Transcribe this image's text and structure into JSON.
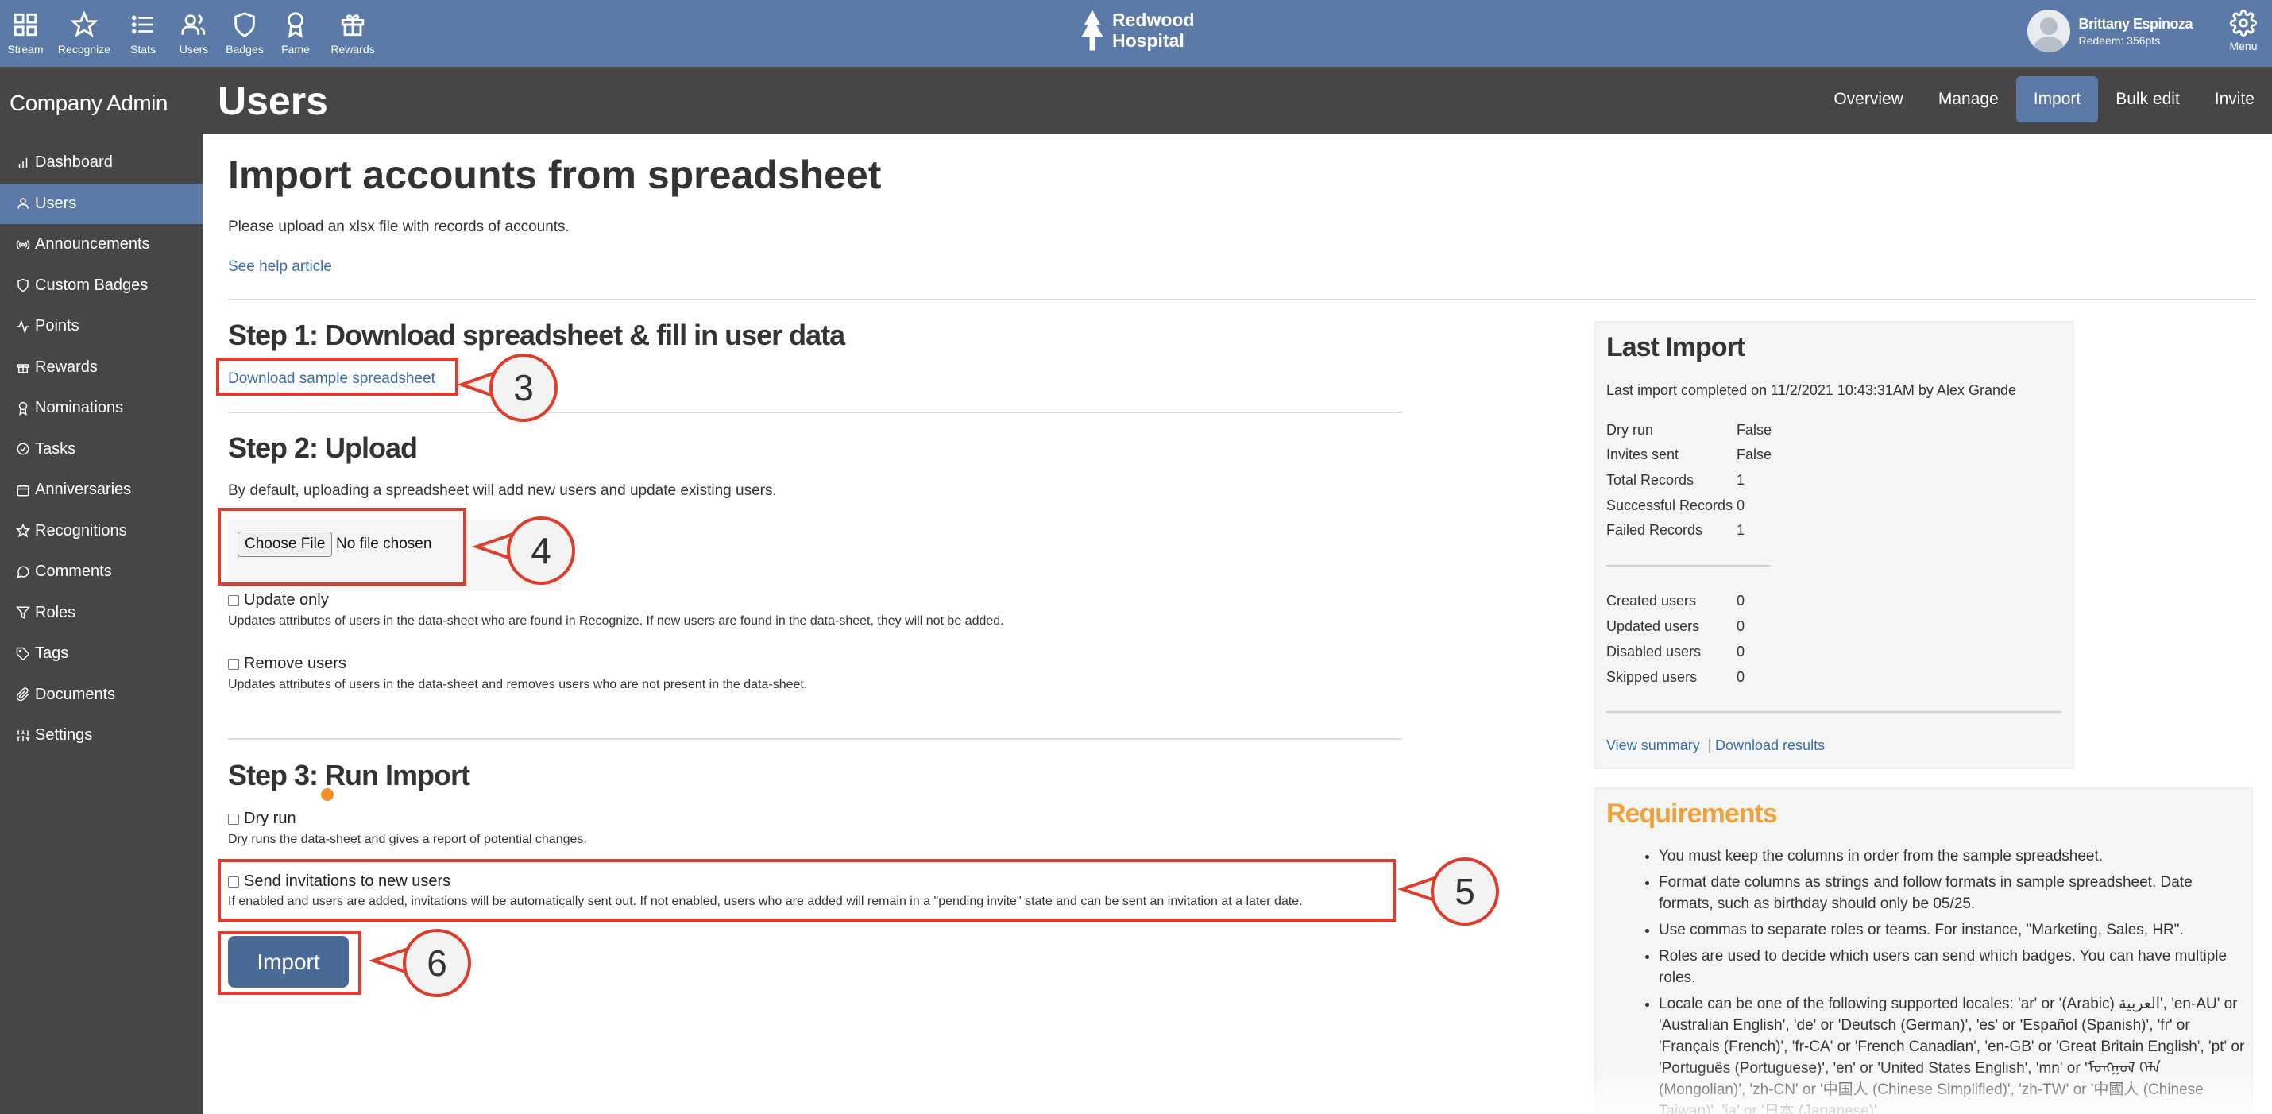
{
  "topnav": {
    "items": [
      {
        "label": "Stream",
        "icon": "grid-icon"
      },
      {
        "label": "Recognize",
        "icon": "star-icon"
      },
      {
        "label": "Stats",
        "icon": "list-icon"
      },
      {
        "label": "Users",
        "icon": "users-icon"
      },
      {
        "label": "Badges",
        "icon": "shield-icon"
      },
      {
        "label": "Fame",
        "icon": "award-icon"
      },
      {
        "label": "Rewards",
        "icon": "gift-icon"
      }
    ],
    "brand_line1": "Redwood",
    "brand_line2": "Hospital",
    "user_name": "Brittany Espinoza",
    "user_points": "Redeem: 356pts",
    "menu_label": "Menu"
  },
  "header": {
    "company": "Company Admin",
    "title": "Users",
    "tabs": [
      "Overview",
      "Manage",
      "Import",
      "Bulk edit",
      "Invite"
    ],
    "active_tab": "Import"
  },
  "sidebar": {
    "items": [
      {
        "label": "Dashboard",
        "icon": "bar-chart-icon"
      },
      {
        "label": "Users",
        "icon": "user-icon"
      },
      {
        "label": "Announcements",
        "icon": "broadcast-icon"
      },
      {
        "label": "Custom Badges",
        "icon": "shield-icon"
      },
      {
        "label": "Points",
        "icon": "pulse-icon"
      },
      {
        "label": "Rewards",
        "icon": "gift-icon"
      },
      {
        "label": "Nominations",
        "icon": "award-icon"
      },
      {
        "label": "Tasks",
        "icon": "check-circle-icon"
      },
      {
        "label": "Anniversaries",
        "icon": "calendar-icon"
      },
      {
        "label": "Recognitions",
        "icon": "star-icon"
      },
      {
        "label": "Comments",
        "icon": "comment-icon"
      },
      {
        "label": "Roles",
        "icon": "filter-icon"
      },
      {
        "label": "Tags",
        "icon": "tag-icon"
      },
      {
        "label": "Documents",
        "icon": "paperclip-icon"
      },
      {
        "label": "Settings",
        "icon": "sliders-icon"
      }
    ],
    "active": "Users"
  },
  "main": {
    "title": "Import accounts from spreadsheet",
    "intro": "Please upload an xlsx file with records of accounts.",
    "help_link": "See help article",
    "step1": {
      "title": "Step 1: Download spreadsheet & fill in user data",
      "link": "Download sample spreadsheet"
    },
    "step2": {
      "title": "Step 2: Upload",
      "desc": "By default, uploading a spreadsheet will add new users and update existing users.",
      "choose_file": "Choose File",
      "no_file": "No file chosen",
      "update_only_label": "Update only",
      "update_only_desc": "Updates attributes of users in the data-sheet who are found in Recognize. If new users are found in the data-sheet, they will not be added.",
      "remove_users_label": "Remove users",
      "remove_users_desc": "Updates attributes of users in the data-sheet and removes users who are not present in the data-sheet."
    },
    "step3": {
      "title": "Step 3: Run Import",
      "dry_run_label": "Dry run",
      "dry_run_desc": "Dry runs the data-sheet and gives a report of potential changes.",
      "send_inv_label": "Send invitations to new users",
      "send_inv_desc": "If enabled and users are added, invitations will be automatically sent out. If not enabled, users who are added will remain in a \"pending invite\" state and can be sent an invitation at a later date.",
      "import_button": "Import"
    }
  },
  "callouts": [
    "3",
    "4",
    "5",
    "6"
  ],
  "last_import": {
    "title": "Last Import",
    "completed": "Last import completed on 11/2/2021 10:43:31AM by Alex Grande",
    "rows1": [
      {
        "label": "Dry run",
        "value": "False"
      },
      {
        "label": "Invites sent",
        "value": "False"
      },
      {
        "label": "Total Records",
        "value": "1"
      },
      {
        "label": "Successful Records",
        "value": "0"
      },
      {
        "label": "Failed Records",
        "value": "1"
      }
    ],
    "rows2": [
      {
        "label": "Created users",
        "value": "0"
      },
      {
        "label": "Updated users",
        "value": "0"
      },
      {
        "label": "Disabled users",
        "value": "0"
      },
      {
        "label": "Skipped users",
        "value": "0"
      }
    ],
    "view_summary": "View summary",
    "separator": "|",
    "download_results": "Download results"
  },
  "requirements": {
    "title": "Requirements",
    "items": [
      "You must keep the columns in order from the sample spreadsheet.",
      "Format date columns as strings and follow formats in sample spreadsheet. Date formats, such as birthday should only be 05/25.",
      "Use commas to separate roles or teams. For instance, \"Marketing, Sales, HR\".",
      "Roles are used to decide which users can send which badges. You can have multiple roles.",
      "Locale can be one of the following supported locales: 'ar' or '(Arabic) العربية', 'en-AU' or 'Australian English', 'de' or 'Deutsch (German)', 'es' or 'Español (Spanish)', 'fr' or 'Français (French)', 'fr-CA' or 'French Canadian', 'en-GB' or 'Great Britain English', 'pt' or 'Português (Portuguese)', 'en' or 'United States English', 'mn' or 'ᠮᠣᠩᠭᠣᠯ ᠬᠡᠯᠡ (Mongolian)', 'zh-CN' or '中国人 (Chinese Simplified)', 'zh-TW' or '中國人 (Chinese Taiwan)', 'ja' or '日本 (Japanese)'."
    ]
  },
  "colors": {
    "topbar": "#5b7aa8",
    "header": "#464646",
    "accent": "#4a6a96",
    "annotation": "#e03c2b",
    "requirements": "#f0a23a"
  }
}
